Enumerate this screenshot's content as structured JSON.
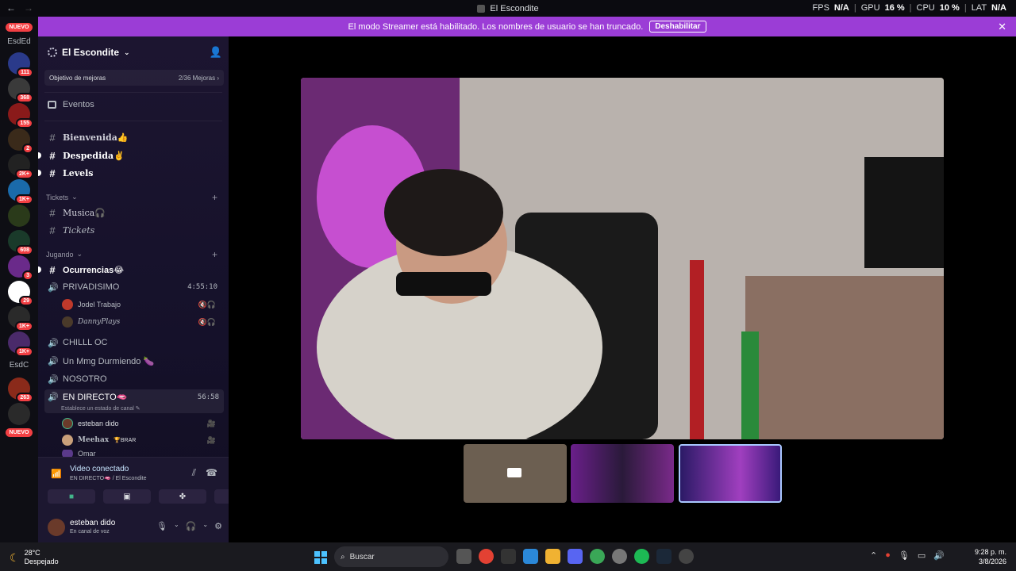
{
  "window": {
    "title": "El Escondite",
    "nav_back": "←",
    "nav_forward": "→"
  },
  "stats": {
    "fps_label": "FPS",
    "fps_value": "N/A",
    "gpu_label": "GPU",
    "gpu_value": "16 %",
    "cpu_label": "CPU",
    "cpu_value": "10 %",
    "lat_label": "LAT",
    "lat_value": "N/A"
  },
  "banner": {
    "text": "El modo Streamer está habilitado. Los nombres de usuario se han truncado.",
    "button": "Deshabilitar",
    "close": "✕"
  },
  "servers": {
    "top_label": "NUEVO",
    "top_server": "EsdEd",
    "items": [
      {
        "badge": "111",
        "color": "#2a3a8a"
      },
      {
        "badge": "368",
        "color": "#3a3a3a"
      },
      {
        "badge": "155",
        "color": "#8a1a1a"
      },
      {
        "badge": "2",
        "color": "#3a2a1a"
      },
      {
        "badge": "2K+",
        "color": "#222"
      },
      {
        "badge": "1K+",
        "color": "#1a6aaa"
      },
      {
        "badge": "",
        "color": "#2a3a1a"
      },
      {
        "badge": "608",
        "color": "#1a3a2a"
      },
      {
        "badge": "3",
        "color": "#6a2a8a"
      },
      {
        "badge": "29",
        "color": "#ffffff"
      },
      {
        "badge": "1K+",
        "color": "#2a2a2a"
      },
      {
        "badge": "1K+",
        "color": "#4a2a6a"
      }
    ],
    "text_server": "EsdC",
    "bottom_items": [
      {
        "badge": "263",
        "color": "#8a2a1a"
      },
      {
        "badge": "",
        "color": "#2a2a2a"
      }
    ],
    "bottom_label": "NUEVO"
  },
  "sidebar": {
    "server_name": "El Escondite",
    "boost_label": "Objetivo de mejoras",
    "boost_progress": "2/36 Mejoras ›",
    "events": "Eventos",
    "channels_top": [
      {
        "name": "Bienvenida👍",
        "bold": false
      },
      {
        "name": "Despedida✌",
        "bold": true
      },
      {
        "name": "Levels",
        "bold": true
      }
    ],
    "cat_tickets": "Tickets",
    "tickets_channels": [
      {
        "name": "Musica🎧"
      },
      {
        "name": "Tickets"
      }
    ],
    "cat_jugando": "Jugando",
    "ocurrencias": "Ocurrencias😂",
    "privadisimo": "PRIVADISIMO",
    "privadisimo_time": "4:55:10",
    "priv_users": [
      {
        "name": "Jodel Trabajo",
        "icons": "🔇🎧"
      },
      {
        "name": "DannyPlays",
        "icons": "🔇🎧"
      }
    ],
    "chill": "CHILLL OC",
    "mmg": "Un Mmg Durmiendo 🍆",
    "nosotro": "NOSOTRO",
    "directo": "EN DIRECTO🫦",
    "directo_time": "56:58",
    "directo_status": "Establece un estado de canal ✎",
    "directo_users": [
      {
        "name": "esteban dido",
        "tag": ""
      },
      {
        "name": "Meehax",
        "tag": "🏆BRAR"
      },
      {
        "name": "Omar",
        "tag": ""
      }
    ]
  },
  "voice": {
    "title": "Video conectado",
    "subtitle": "EN DIRECTO🫦 / El Escondite",
    "user_name": "esteban dido",
    "user_status": "En canal de voz"
  },
  "taskbar": {
    "temp": "28°C",
    "weather": "Despejado",
    "search": "Buscar",
    "time": "9:28 p. m.",
    "date": "3/8/2026"
  }
}
